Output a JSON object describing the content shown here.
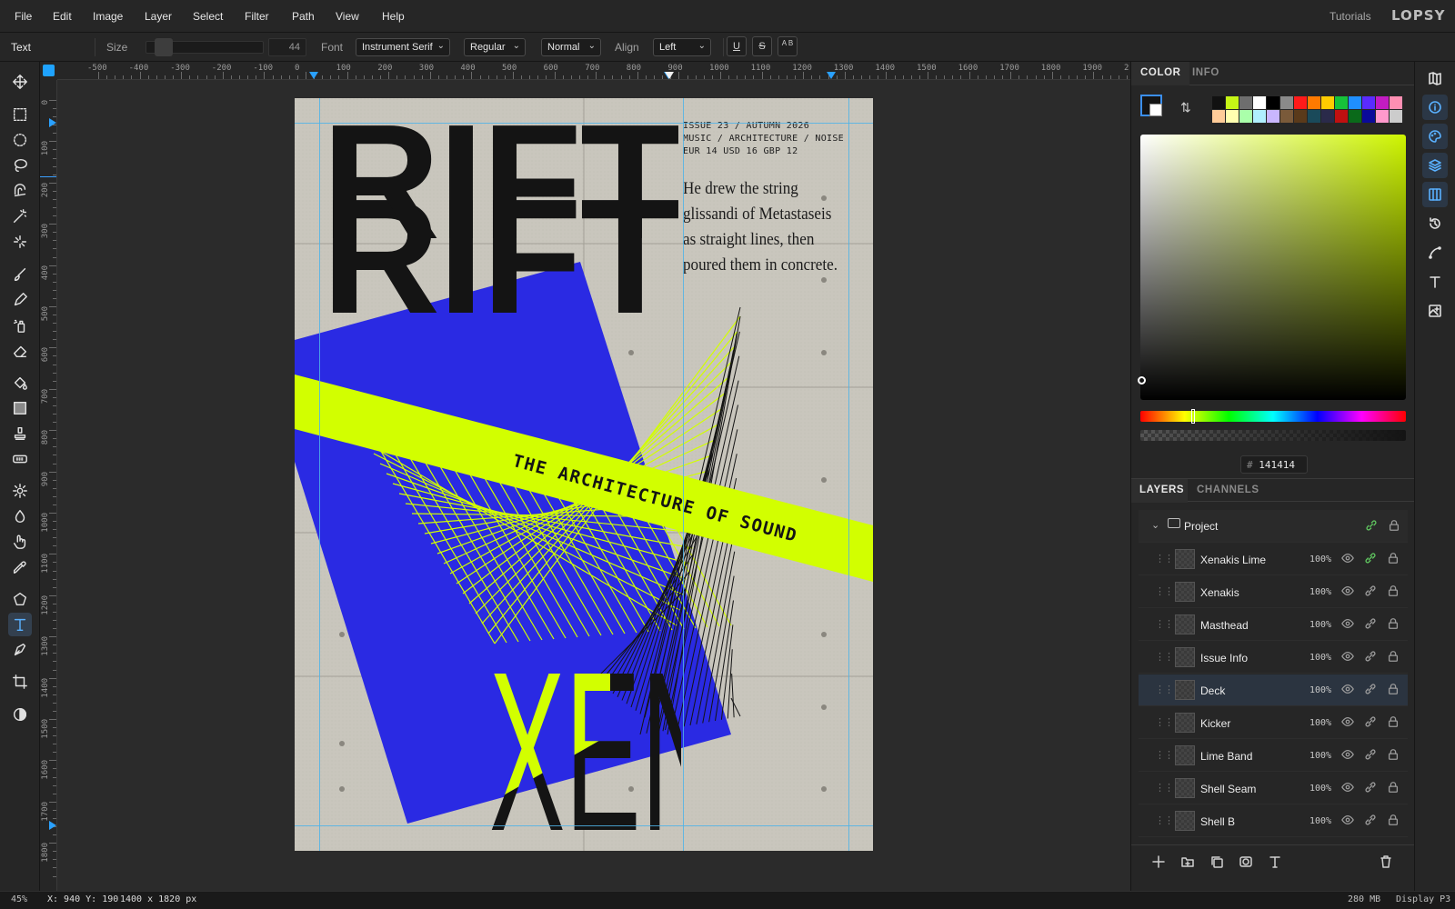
{
  "menu": {
    "items": [
      "File",
      "Edit",
      "Image",
      "Layer",
      "Select",
      "Filter",
      "Path",
      "View",
      "Help"
    ],
    "tutorials": "Tutorials",
    "logo": "LOPSY"
  },
  "options": {
    "tool_name": "Text",
    "size_label": "Size",
    "size_value": "44",
    "font_label": "Font",
    "font_value": "Instrument Serif",
    "weight_value": "Regular",
    "style_value": "Normal",
    "align_label": "Align",
    "align_value": "Left",
    "underline": "U",
    "strike": "S",
    "case": "A B"
  },
  "tools": [
    "move",
    "rect-select",
    "ellipse-select",
    "lasso",
    "magnetic-lasso",
    "magic-wand",
    "quick-select",
    "brush",
    "pencil",
    "spray",
    "eraser",
    "fill",
    "gradient",
    "stamp",
    "healing",
    "dodge",
    "burn",
    "smudge",
    "eyedropper",
    "shape",
    "text",
    "pen",
    "crop",
    "adjust"
  ],
  "active_tool": "text",
  "ruler": {
    "top_labels": [
      "-500",
      "-400",
      "-300",
      "-200",
      "-100",
      "0",
      "100",
      "200",
      "300",
      "400",
      "500",
      "600",
      "700",
      "800",
      "900",
      "1000",
      "1100",
      "1200",
      "1300",
      "1400",
      "1500",
      "1600",
      "1700",
      "1800",
      "1900",
      "2"
    ],
    "left_labels": [
      "0",
      "100",
      "200",
      "300",
      "400",
      "500",
      "600",
      "700",
      "800",
      "900",
      "1000",
      "1100",
      "1200",
      "1300",
      "1400",
      "1500",
      "1600",
      "1700",
      "1800"
    ]
  },
  "poster": {
    "masthead_top": "RIFT",
    "masthead_bottom": "RIFT",
    "issue_lines": [
      "ISSUE 23 / AUTUMN 2026",
      "MUSIC / ARCHITECTURE / NOISE",
      "EUR 14  USD 16  GBP 12"
    ],
    "deck": "He drew the string\nglissandi of Metastaseis\nas straight lines, then\npoured them in concrete.",
    "kicker": "THE ARCHITECTURE OF SOUND",
    "title": "XENAKIS",
    "colors": {
      "blue": "#2a2ae3",
      "lime": "#d2ff00",
      "ink": "#141414",
      "concrete": "#c8c5bc"
    }
  },
  "color_panel": {
    "tabs": [
      "COLOR",
      "INFO"
    ],
    "hex_prefix": "#",
    "hex": "141414",
    "swatches_row1": [
      "#111111",
      "#c6f516",
      "#6e6e6e",
      "#ffffff",
      "#000000",
      "#8a8a8a",
      "#ff1a1a",
      "#ff7a00",
      "#ffcc00",
      "#16c23a",
      "#1f8fff",
      "#5a2bff",
      "#c21cc2",
      "#ff8fb3"
    ],
    "swatches_row2": [
      "#ffcc99",
      "#ffffb0",
      "#aaffaa",
      "#b0f0ff",
      "#c9b6ff",
      "#7a5a3a",
      "#5a3a1a",
      "#1a4a5a",
      "#2a2a4a",
      "#c01010",
      "#0a6a1a",
      "#0a0a9a",
      "#ff99cc",
      "#cccccc"
    ]
  },
  "layers_panel": {
    "tabs": [
      "LAYERS",
      "CHANNELS"
    ],
    "group": "Project",
    "layers": [
      {
        "name": "Xenakis Lime",
        "opacity": "100%"
      },
      {
        "name": "Xenakis",
        "opacity": "100%"
      },
      {
        "name": "Masthead",
        "opacity": "100%"
      },
      {
        "name": "Issue Info",
        "opacity": "100%"
      },
      {
        "name": "Deck",
        "opacity": "100%"
      },
      {
        "name": "Kicker",
        "opacity": "100%"
      },
      {
        "name": "Lime Band",
        "opacity": "100%"
      },
      {
        "name": "Shell Seam",
        "opacity": "100%"
      },
      {
        "name": "Shell B",
        "opacity": "100%"
      }
    ],
    "selected": "Deck"
  },
  "status": {
    "zoom": "45%",
    "coords": "X: 940 Y: 190",
    "doc_size": "1400 x 1820 px",
    "memory": "280 MB",
    "profile": "Display P3"
  }
}
